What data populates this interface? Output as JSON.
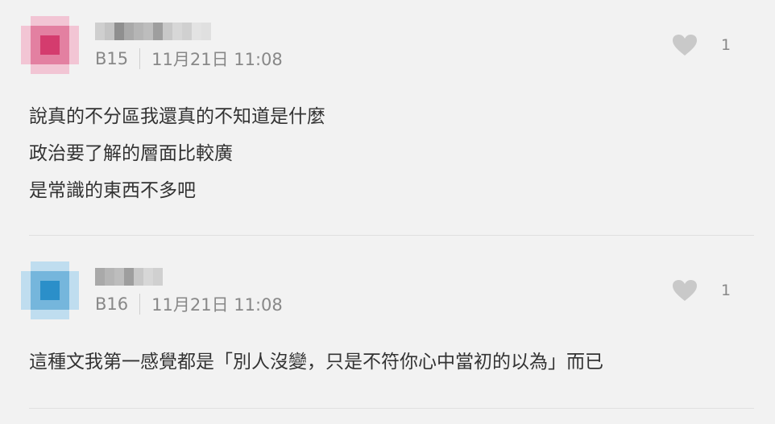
{
  "comments": [
    {
      "floor": "B15",
      "datetime": "11月21日 11:08",
      "likes": "1",
      "avatar_color": "#d43c6e",
      "lines": [
        "說真的不分區我還真的不知道是什麼",
        "政治要了解的層面比較廣",
        "是常識的東西不多吧"
      ]
    },
    {
      "floor": "B16",
      "datetime": "11月21日 11:08",
      "likes": "1",
      "avatar_color": "#2b8fc9",
      "lines": [
        "這種文我第一感覺都是「別人沒變，只是不符你心中當初的以為」而已"
      ]
    }
  ]
}
